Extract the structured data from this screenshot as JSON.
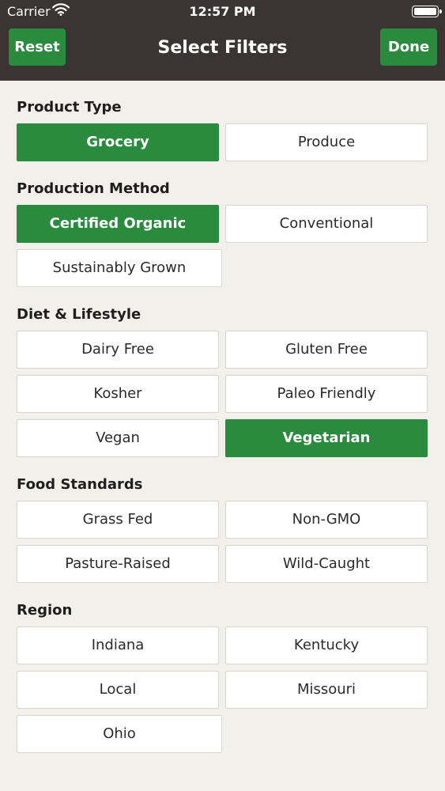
{
  "status_bar": {
    "carrier": "Carrier",
    "time": "12:57 PM",
    "wifi_icon": "wifi-icon",
    "battery_icon": "battery-icon"
  },
  "nav": {
    "title": "Select Filters",
    "reset_label": "Reset",
    "done_label": "Done"
  },
  "colors": {
    "header_bg": "#3a3533",
    "accent": "#2a8a3e",
    "page_bg": "#f2f0eb"
  },
  "sections": [
    {
      "title": "Product Type",
      "options": [
        {
          "label": "Grocery",
          "selected": true
        },
        {
          "label": "Produce",
          "selected": false
        }
      ]
    },
    {
      "title": "Production Method",
      "options": [
        {
          "label": "Certified Organic",
          "selected": true
        },
        {
          "label": "Conventional",
          "selected": false
        },
        {
          "label": "Sustainably Grown",
          "selected": false
        }
      ]
    },
    {
      "title": "Diet & Lifestyle",
      "options": [
        {
          "label": "Dairy Free",
          "selected": false
        },
        {
          "label": "Gluten Free",
          "selected": false
        },
        {
          "label": "Kosher",
          "selected": false
        },
        {
          "label": "Paleo Friendly",
          "selected": false
        },
        {
          "label": "Vegan",
          "selected": false
        },
        {
          "label": "Vegetarian",
          "selected": true
        }
      ]
    },
    {
      "title": "Food Standards",
      "options": [
        {
          "label": "Grass Fed",
          "selected": false
        },
        {
          "label": "Non-GMO",
          "selected": false
        },
        {
          "label": "Pasture-Raised",
          "selected": false
        },
        {
          "label": "Wild-Caught",
          "selected": false
        }
      ]
    },
    {
      "title": "Region",
      "options": [
        {
          "label": "Indiana",
          "selected": false
        },
        {
          "label": "Kentucky",
          "selected": false
        },
        {
          "label": "Local",
          "selected": false
        },
        {
          "label": "Missouri",
          "selected": false
        },
        {
          "label": "Ohio",
          "selected": false
        }
      ]
    }
  ]
}
